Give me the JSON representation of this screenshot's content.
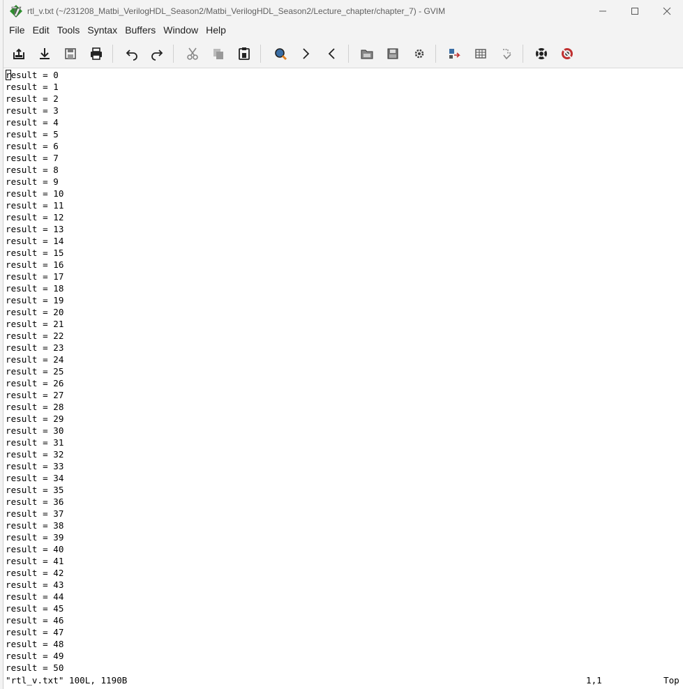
{
  "window": {
    "title": "rtl_v.txt (~/231208_Matbi_VerilogHDL_Season2/Matbi_VerilogHDL_Season2/Lecture_chapter/chapter_7) - GVIM",
    "app_icon": "gvim-icon",
    "controls": [
      {
        "name": "minimize-icon"
      },
      {
        "name": "maximize-icon"
      },
      {
        "name": "close-icon"
      }
    ]
  },
  "menu": {
    "items": [
      "File",
      "Edit",
      "Tools",
      "Syntax",
      "Buffers",
      "Window",
      "Help"
    ]
  },
  "toolbar": {
    "buttons": [
      {
        "icon": "open-file-icon"
      },
      {
        "icon": "save-download-icon"
      },
      {
        "icon": "save-all-icon"
      },
      {
        "icon": "print-icon"
      },
      {
        "icon": "undo-icon"
      },
      {
        "icon": "redo-icon"
      },
      {
        "icon": "cut-icon"
      },
      {
        "icon": "copy-icon"
      },
      {
        "icon": "paste-icon"
      },
      {
        "icon": "find-replace-icon"
      },
      {
        "icon": "find-next-icon"
      },
      {
        "icon": "find-previous-icon"
      },
      {
        "icon": "load-session-icon"
      },
      {
        "icon": "save-session-icon"
      },
      {
        "icon": "run-script-icon"
      },
      {
        "icon": "make-icon"
      },
      {
        "icon": "shell-icon"
      },
      {
        "icon": "run-ctags-icon"
      },
      {
        "icon": "help-icon"
      },
      {
        "icon": "find-help-icon"
      }
    ]
  },
  "editor": {
    "lines": [
      "result = 0",
      "result = 1",
      "result = 2",
      "result = 3",
      "result = 4",
      "result = 5",
      "result = 6",
      "result = 7",
      "result = 8",
      "result = 9",
      "result = 10",
      "result = 11",
      "result = 12",
      "result = 13",
      "result = 14",
      "result = 15",
      "result = 16",
      "result = 17",
      "result = 18",
      "result = 19",
      "result = 20",
      "result = 21",
      "result = 22",
      "result = 23",
      "result = 24",
      "result = 25",
      "result = 26",
      "result = 27",
      "result = 28",
      "result = 29",
      "result = 30",
      "result = 31",
      "result = 32",
      "result = 33",
      "result = 34",
      "result = 35",
      "result = 36",
      "result = 37",
      "result = 38",
      "result = 39",
      "result = 40",
      "result = 41",
      "result = 42",
      "result = 43",
      "result = 44",
      "result = 45",
      "result = 46",
      "result = 47",
      "result = 48",
      "result = 49",
      "result = 50"
    ]
  },
  "status": {
    "file_info": "\"rtl_v.txt\" 100L, 1190B",
    "position": "1,1",
    "scroll": "Top"
  }
}
